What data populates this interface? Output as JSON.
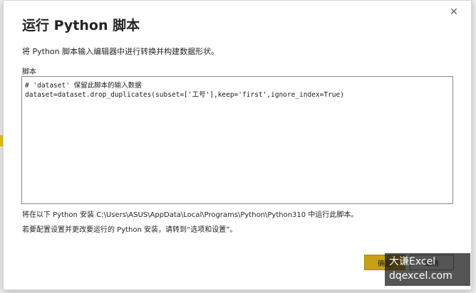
{
  "dialog": {
    "title": "运行 Python 脚本",
    "close_glyph": "✕",
    "description": "将 Python 脚本输入编辑器中进行转换并构建数据形状。",
    "script_label": "脚本",
    "code_lines": [
      "# 'dataset' 保留此脚本的输入数据",
      "dataset=dataset.drop_duplicates(subset=['工号'],keep='first',ignore_index=True)"
    ],
    "install_note": "将在以下 Python 安装 C:\\Users\\ASUS\\AppData\\Local\\Programs\\Python\\Python310 中运行此脚本。",
    "settings_note": "若要配置设置并更改要运行的 Python 安装，请转到“选项和设置”。",
    "ok_label": "确定",
    "cancel_label": "取消"
  },
  "watermark": {
    "line1": "大谦Excel",
    "line2": "dqexcel.com"
  },
  "colors": {
    "accent": "#c8a016",
    "border": "#8a8886",
    "text": "#252423"
  }
}
